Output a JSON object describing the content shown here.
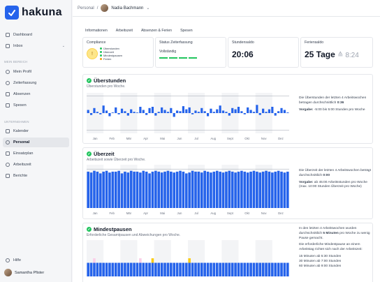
{
  "app": {
    "name": "hakuna"
  },
  "sidebar": {
    "top_items": [
      {
        "label": "Dashboard",
        "icon": "home-icon"
      },
      {
        "label": "Inbox",
        "icon": "inbox-icon"
      }
    ],
    "section_my": "MEIN BEREICH",
    "my_items": [
      {
        "label": "Mein Profil",
        "icon": "profile-icon"
      },
      {
        "label": "Zeiterfassung",
        "icon": "clock-icon"
      },
      {
        "label": "Absenzen",
        "icon": "calendar-icon"
      },
      {
        "label": "Spesen",
        "icon": "receipt-icon"
      }
    ],
    "section_company": "UNTERNEHMEN",
    "company_items": [
      {
        "label": "Kalender",
        "icon": "calendar-icon"
      },
      {
        "label": "Personal",
        "icon": "people-icon",
        "active": true
      },
      {
        "label": "Einsatzplan",
        "icon": "plan-icon"
      },
      {
        "label": "Arbeitszeit",
        "icon": "worktime-icon"
      },
      {
        "label": "Berichte",
        "icon": "reports-icon"
      }
    ],
    "help": "Hilfe",
    "user": "Samantha Pfister"
  },
  "topbar": {
    "breadcrumb": "Personal",
    "separator": "/",
    "person": "Nadia Bachmann",
    "dropdown_icon": "chevron-down-icon"
  },
  "tabs": [
    "Informationen",
    "Arbeitszeit",
    "Absenzen & Ferien",
    "Spesen"
  ],
  "stats": {
    "compliance": {
      "title": "Compliance",
      "legend": [
        {
          "label": "Überstunden",
          "color": "#22c55e"
        },
        {
          "label": "Überzeit",
          "color": "#22c55e"
        },
        {
          "label": "Mindestpausen",
          "color": "#22c55e"
        },
        {
          "label": "Ferien",
          "color": "#f59e0b"
        }
      ]
    },
    "status": {
      "title": "Status Zeiterfassung",
      "value": "Vollständig"
    },
    "saldo": {
      "title": "Stundensaldo",
      "value": "20:06"
    },
    "ferien": {
      "title": "Feriensaldo",
      "value": "25 Tage",
      "sub": "≙ 8:24"
    }
  },
  "cards": {
    "ueberstunden": {
      "title": "Überstunden",
      "subtitle": "Überstunden pro Woche.",
      "note_p1": "Die Überstunden der letzten 4 Arbeitswochen betragen durchschnittlich",
      "note_val": "0:36",
      "note_p2_bold": "Vorgabe:",
      "note_p2": "-5:00 bis 5:00 Stunden pro Woche"
    },
    "ueberzeit": {
      "title": "Überzeit",
      "subtitle": "Arbeitszeit sowie Überzeit pro Woche.",
      "note_p1": "Die Überzeit der letzten 4 Arbeitswochen beträgt durchschnittlich",
      "note_val": "0:00",
      "note_p2_bold": "Vorgabe:",
      "note_p2": "ab 45:00 Arbeitsstunden pro Woche (max. 10:00 Stunden Überzeit pro Woche)"
    },
    "mindestpausen": {
      "title": "Mindestpausen",
      "subtitle": "Erforderliche Gesamtpausen und Abweichungen pro Woche.",
      "note_p1a": "In den letzten 4 Arbeitswochen wurden durchschnittlich",
      "note_val": "5 Minuten",
      "note_p1b": "pro Woche zu wenig Pause gemacht.",
      "note_p2": "Die erforderliche Mindestpause an einem Arbeitstag richtet sich nach der Arbeitszeit:",
      "rules": [
        "15 Minuten ab 5:30 Stunden",
        "30 Minuten ab 7:00 Stunden",
        "60 Minuten ab 9:00 Stunden"
      ]
    }
  },
  "chart_data": [
    {
      "type": "bar",
      "title": "Überstunden",
      "categories": [
        "Jan",
        "Feb",
        "Mär",
        "Apr",
        "Mai",
        "Jun",
        "Jul",
        "Aug",
        "Sept",
        "Okt",
        "Nov",
        "Dez"
      ],
      "series": [
        {
          "values": [
            0.5,
            -0.3,
            0.8,
            0.2,
            -0.2,
            1.2,
            0.4,
            -0.5,
            0.1,
            0.9,
            -0.2,
            0.7,
            0.3,
            -0.4,
            0.6,
            0.2,
            0.0,
            1.0,
            0.5,
            -0.3,
            0.8,
            1.0,
            -0.4,
            0.2,
            0.9,
            0.5,
            0.2,
            0.8,
            -0.6,
            0.4,
            0.3,
            1.1,
            0.6,
            0.9,
            -0.2,
            0.4,
            0.2,
            0.8,
            0.3,
            -0.5,
            0.7,
            0.2,
            0.6,
            1.2,
            0.4,
            0.2,
            -0.4,
            0.8,
            0.6,
            1.0,
            0.3,
            -0.2,
            0.9,
            0.5,
            0.2,
            1.3,
            -0.3,
            0.7,
            0.2,
            0.6,
            1.0,
            -0.4,
            0.3,
            0.8,
            0.5,
            0.1
          ]
        }
      ]
    },
    {
      "type": "bar",
      "title": "Überzeit",
      "categories": [
        "Jan",
        "Feb",
        "Mär",
        "Apr",
        "Mai",
        "Jun",
        "Jul",
        "Aug",
        "Sept",
        "Okt",
        "Nov",
        "Dez"
      ],
      "ylim": [
        0,
        50
      ],
      "series": [
        {
          "values": [
            42,
            41,
            43,
            42,
            40,
            42,
            43,
            41,
            42,
            42,
            43,
            40,
            42,
            41,
            43,
            42,
            42,
            41,
            43,
            42,
            40,
            42,
            43,
            42,
            41,
            42,
            43,
            42,
            41,
            42,
            43,
            42,
            40,
            41,
            43,
            42,
            42,
            41,
            43,
            42,
            41,
            42,
            43,
            42,
            41,
            42,
            43,
            42,
            41,
            42,
            43,
            42,
            41,
            42,
            43,
            42,
            41,
            42,
            43,
            42,
            41,
            42,
            43,
            42,
            41,
            42
          ]
        }
      ]
    },
    {
      "type": "bar",
      "title": "Mindestpausen",
      "series": [
        {
          "values": [
            3,
            3,
            3,
            3,
            3,
            3,
            3,
            3,
            3,
            3,
            3,
            3,
            3,
            3,
            3,
            3,
            3,
            3,
            3,
            3,
            3,
            3,
            3,
            3,
            3,
            3,
            3,
            3,
            3,
            3,
            3,
            3,
            3,
            3,
            3,
            3,
            3,
            3,
            3,
            3,
            3,
            3,
            3,
            3,
            3,
            3,
            3,
            3,
            3,
            3,
            3,
            3,
            3,
            3,
            3,
            3,
            3,
            3,
            3,
            3,
            3,
            3,
            3,
            3,
            3,
            3
          ]
        },
        {
          "values": [
            0,
            0,
            1,
            0,
            0,
            0,
            0,
            0,
            0,
            0,
            0,
            0,
            0,
            0,
            0,
            0,
            0,
            1,
            0,
            0,
            0,
            0,
            0,
            0,
            0,
            0,
            0,
            0,
            0,
            0,
            0,
            0,
            0,
            0,
            0,
            0,
            0,
            0,
            0,
            0,
            0,
            0,
            0,
            0,
            0,
            0,
            0,
            0,
            0,
            0,
            0,
            0,
            0,
            0,
            0,
            0,
            0,
            0,
            0,
            0,
            0,
            0,
            0,
            0,
            0,
            0
          ]
        },
        {
          "values": [
            0,
            0,
            0,
            0,
            0,
            0,
            0,
            0,
            0,
            0,
            0,
            0,
            0,
            0,
            0,
            0,
            0,
            0,
            0,
            0,
            0,
            1,
            0,
            0,
            0,
            0,
            0,
            0,
            0,
            0,
            0,
            0,
            0,
            1,
            0,
            0,
            0,
            0,
            0,
            0,
            0,
            0,
            0,
            0,
            0,
            0,
            0,
            0,
            0,
            0,
            0,
            0,
            0,
            0,
            0,
            0,
            0,
            0,
            0,
            0,
            0,
            0,
            0,
            0,
            0,
            0
          ]
        }
      ]
    }
  ],
  "colors": {
    "accent": "#2563eb",
    "success": "#22c55e",
    "warning": "#facc15",
    "deviation": "#fbcfe8"
  }
}
